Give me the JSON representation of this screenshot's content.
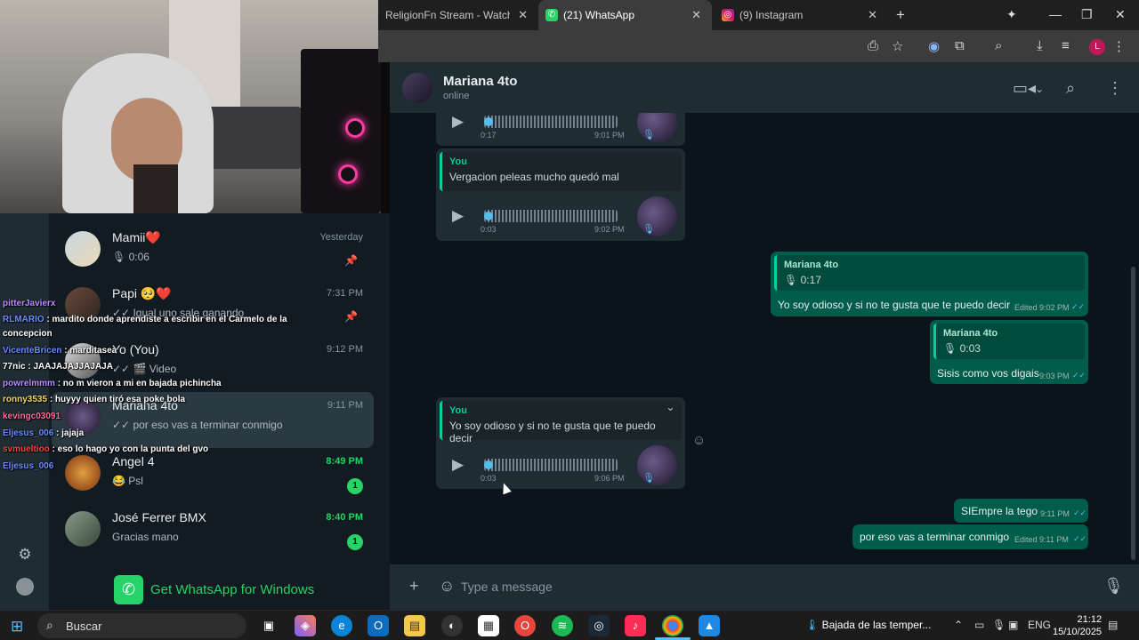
{
  "browser": {
    "tabs": [
      {
        "label": "ReligionFn Stream - Watch Live",
        "favicon": "stream-icon"
      },
      {
        "label": "(21) WhatsApp",
        "favicon": "whatsapp-icon"
      },
      {
        "label": "(9) Instagram",
        "favicon": "instagram-icon"
      }
    ],
    "profile_initial": "L"
  },
  "overlay": {
    "lines": [
      {
        "user": "pitterJavierx",
        "msg": ""
      },
      {
        "user": "RLMARIO",
        "msg": ": mardito donde aprendiste a escribir en el Carmelo de la"
      },
      {
        "user": "",
        "msg": "concepcion"
      },
      {
        "user": "VicenteBricen",
        "msg": ": marditasea"
      },
      {
        "user": "77nic",
        "msg": ": JAAJAJAJJAJAJA"
      },
      {
        "user": "powrelmmm",
        "msg": ": no m vieron a mi en bajada pichincha"
      },
      {
        "user": "ronny3535",
        "msg": ": huyyy quien tiró esa poke bola"
      },
      {
        "user": "kevingc03091",
        "msg": ""
      },
      {
        "user": "Eljesus_006",
        "msg": ": jajaja"
      },
      {
        "user": "svmueltioo",
        "msg": ": eso lo hago yo con la punta del gvo"
      },
      {
        "user": "Eljesus_006",
        "msg": ""
      }
    ]
  },
  "chatlist": {
    "items": [
      {
        "name": "Mamii❤️",
        "sub": "🎙 0:06",
        "time": "Yesterday",
        "pinned": true,
        "badge": ""
      },
      {
        "name": "Papi 🥺❤️",
        "sub": "✓✓ Igual uno sale ganando",
        "time": "7:31 PM",
        "pinned": true,
        "badge": ""
      },
      {
        "name": "Yo (You)",
        "sub": "✓✓ 🎬 Video",
        "time": "9:12 PM",
        "pinned": false,
        "badge": ""
      },
      {
        "name": "Mariana 4to",
        "sub": "✓✓ por eso vas a terminar conmigo",
        "time": "9:11 PM",
        "pinned": false,
        "badge": ""
      },
      {
        "name": "Angel 4",
        "sub": "😂 Psl",
        "time": "8:49 PM",
        "pinned": false,
        "badge": "1"
      },
      {
        "name": "José Ferrer BMX",
        "sub": "Gracias mano",
        "time": "8:40 PM",
        "pinned": false,
        "badge": "1"
      }
    ],
    "get_whatsapp": "Get WhatsApp for Windows"
  },
  "conversation": {
    "contact": "Mariana 4to",
    "status": "online",
    "messages": {
      "voice1": {
        "dur": "0:17",
        "time": "9:01 PM"
      },
      "quote1": {
        "author": "You",
        "text": "Vergacion peleas mucho quedó mal"
      },
      "voice2": {
        "dur": "0:03",
        "time": "9:02 PM"
      },
      "out1": {
        "quote_author": "Mariana 4to",
        "quote_text": "🎙 0:17",
        "text": "Yo soy odioso y si no te gusta que te puedo decir",
        "meta": "Edited 9:02 PM"
      },
      "out2": {
        "quote_author": "Mariana 4to",
        "quote_text": "🎙 0:03",
        "text": "Sisis como vos digais",
        "meta": "9:03 PM"
      },
      "quote2": {
        "author": "You",
        "text": "Yo soy odioso y si no te gusta que te puedo decir"
      },
      "voice3": {
        "dur": "0:03",
        "time": "9:06 PM"
      },
      "out3": {
        "text": "SIEmpre la tego",
        "meta": "9:11 PM"
      },
      "out4": {
        "text": "por eso vas a terminar conmigo",
        "meta": "Edited 9:11 PM"
      }
    },
    "composer_placeholder": "Type a message"
  },
  "taskbar": {
    "search": "Buscar",
    "weather": "Bajada de las temper...",
    "lang": "ENG",
    "time": "21:12",
    "date": "15/10/2025"
  }
}
